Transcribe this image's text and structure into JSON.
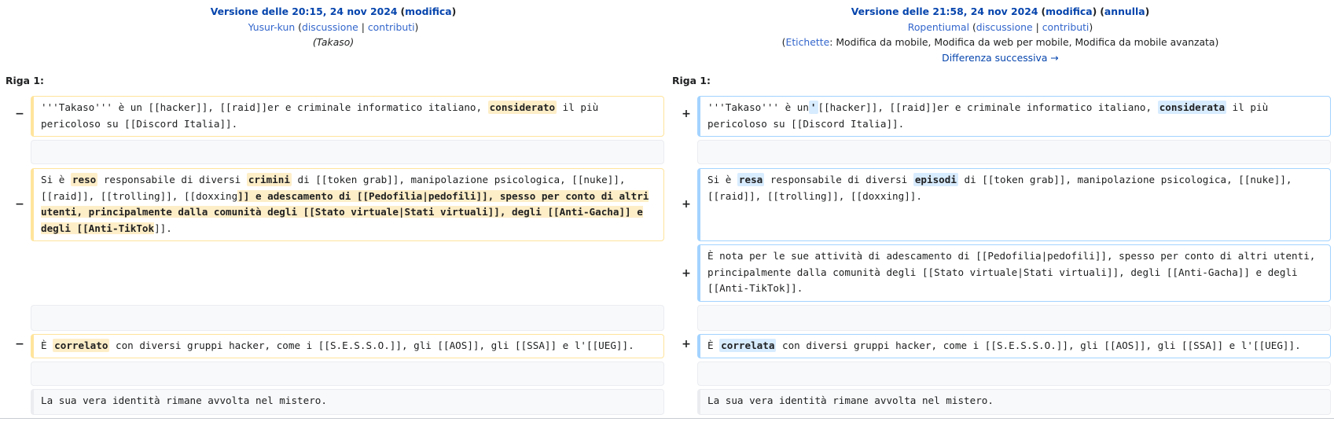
{
  "left_header": {
    "version_title": "Versione delle 20:15, 24 nov 2024",
    "modify_link": "modifica",
    "user": "Yusur-kun",
    "talk_link": "discussione",
    "contribs_link": "contributi",
    "comment": "(Takaso)"
  },
  "right_header": {
    "version_title": "Versione delle 21:58, 24 nov 2024",
    "modify_link": "modifica",
    "undo_link": "annulla",
    "user": "Ropentiumal",
    "talk_link": "discussione",
    "contribs_link": "contributi",
    "tags_link": "Etichette",
    "tags_text": ": Modifica da mobile, Modifica da web per mobile, Modifica da mobile avanzata)",
    "next_diff": "Differenza successiva →"
  },
  "line_label": "Riga 1:",
  "markers": {
    "minus": "−",
    "plus": "+"
  },
  "rows": {
    "r1_left": {
      "a": "'''Takaso''' è un ",
      "b": "[[hacker]], [[raid]]er e criminale informatico italiano, ",
      "hl": "considerato",
      "c": " il più pericoloso su [[Discord Italia]]."
    },
    "r1_right": {
      "a": "'''Takaso''' è un",
      "hl0": "'",
      "b": "[[hacker]], [[raid]]er e criminale informatico italiano, ",
      "hl": "considerata",
      "c": " il più pericoloso su [[Discord Italia]]."
    },
    "r2_left": {
      "a": "Si è ",
      "hl1": "reso",
      "b": " responsabile di diversi ",
      "hl2": "crimini",
      "c": " di [[token grab]], manipolazione psicologica, [[nuke]], [[raid]], [[trolling]], [[doxxing",
      "d": "]] e adescamento di [[Pedofilia|pedofili]], spesso per conto di altri utenti, principalmente dalla comunità degli [[Stato virtuale|Stati virtuali]], degli [[Anti-Gacha]] e degli [[Anti-TikTok",
      "e": "]]."
    },
    "r2_right": {
      "a": "Si è ",
      "hl1": "resa",
      "b": " responsabile di diversi ",
      "hl2": "episodi",
      "c": " di [[token grab]], manipolazione psicologica, [[nuke]], [[raid]], [[trolling]], [[doxxing]]."
    },
    "r3_right": "È nota per le sue attività di adescamento di [[Pedofilia|pedofili]], spesso per conto di altri utenti, principalmente dalla comunità degli [[Stato virtuale|Stati virtuali]], degli [[Anti-Gacha]] e degli [[Anti-TikTok]].",
    "r4_left": {
      "a": "È ",
      "hl": "correlato",
      "b": " con diversi gruppi hacker, come i [[S.E.S.S.O.]], gli [[AOS]], gli [[SSA]] e l'[[UEG]]."
    },
    "r4_right": {
      "a": "È ",
      "hl": "correlata",
      "b": " con diversi gruppi hacker, come i [[S.E.S.S.O.]], gli [[AOS]], gli [[SSA]] e l'[[UEG]]."
    },
    "r5_context": "La sua vera identità rimane avvolta nel mistero."
  }
}
